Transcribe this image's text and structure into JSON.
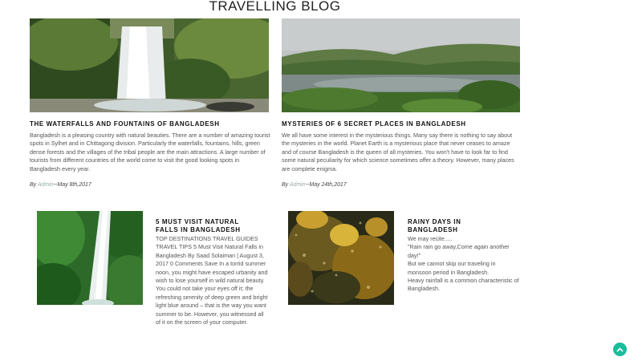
{
  "page": {
    "title": "TRAVELLING BLOG"
  },
  "posts": [
    {
      "title": "THE WATERFALLS AND FOUNTAINS OF BANGLADESH",
      "body": "Bangladesh is a pleasing country with natural beauties. There are a number of amazing tourist spots in Sylhet and in Chittagong division. Particularly the waterfalls, fountains, hills, green dense forests and the villages of the tribal people are the main attractions. A large number of tourists from different countries of the world come to visit the good looking spots in Bangladesh every year.",
      "by": "By",
      "author": "Admin",
      "date": "--May 8th,2017"
    },
    {
      "title": "MYSTERIES OF 6 SECRET PLACES IN BANGLADESH",
      "body": "We all have some interest in the mysterious things. Many say there is nothing to say about the mysteries in the world. Planet Earth is a mysterious place that never ceases to amaze and of course Bangladesh is the queen of all mysteries. You won't have to look far to find some natural peculiarity for which science sometimes offer a theory. However, many places are complete enigma.",
      "by": "By",
      "author": "Admin",
      "date": "--May 24th,2017"
    },
    {
      "title": "5 MUST VISIT NATURAL FALLS IN BANGLADESH",
      "body": "TOP DESTINATIONS TRAVEL GUIDES TRAVEL TIPS 5 Must Visit Natural Falls in Bangladesh By Saad Solaiman | August 3, 2017 0 Comments Save In a torrid summer noon, you might have escaped urbanity and wish to lose yourself in wild natural beauty. You could not take your eyes off it; the refreshing serenity of deep green and bright light blue around – that is the way you want summer to be. However, you witnessed all of it on the screen of your computer."
    },
    {
      "title": "RAINY DAYS IN BANGLADESH",
      "body_lines": [
        "We may recite.....",
        "\"Rain rain go away,Come again another day!\"",
        "But we cannot skip our traveling in monsoon period in Bangladesh.",
        "Heavy rainfall is a common characteristic of Bangladesh."
      ]
    }
  ],
  "icons": {
    "scroll_top": "chevron-up-icon"
  },
  "colors": {
    "accent": "#1abc9c",
    "author": "#99aaaa"
  }
}
